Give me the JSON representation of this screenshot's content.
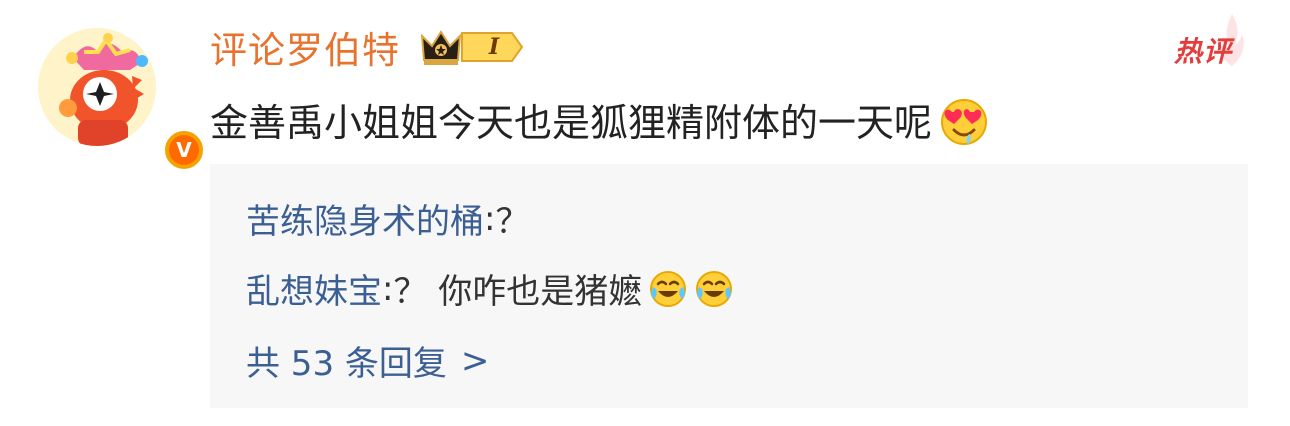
{
  "post": {
    "username": "评论罗伯特",
    "rank_level": "I",
    "hot_tag": "热评",
    "comment": "金善禹小姐姐今天也是狐狸精附体的一天呢",
    "comment_emoji": "heart-eyes-drool-emoji",
    "verified_icon": "V"
  },
  "replies": [
    {
      "user": "苦练隐身术的桶",
      "separator": ":",
      "content": "？"
    },
    {
      "user": "乱想妹宝",
      "separator": ":",
      "content": "？ 你咋也是猪嬷",
      "emojis": [
        "laugh-cry-emoji",
        "laugh-cry-emoji"
      ]
    }
  ],
  "more_replies": {
    "label": "共 53 条回复",
    "arrow": ">"
  },
  "colors": {
    "username": "#e8732e",
    "reply_user": "#3b5f93",
    "hot": "#e33e3e",
    "reply_bg": "#f7f7f7"
  }
}
